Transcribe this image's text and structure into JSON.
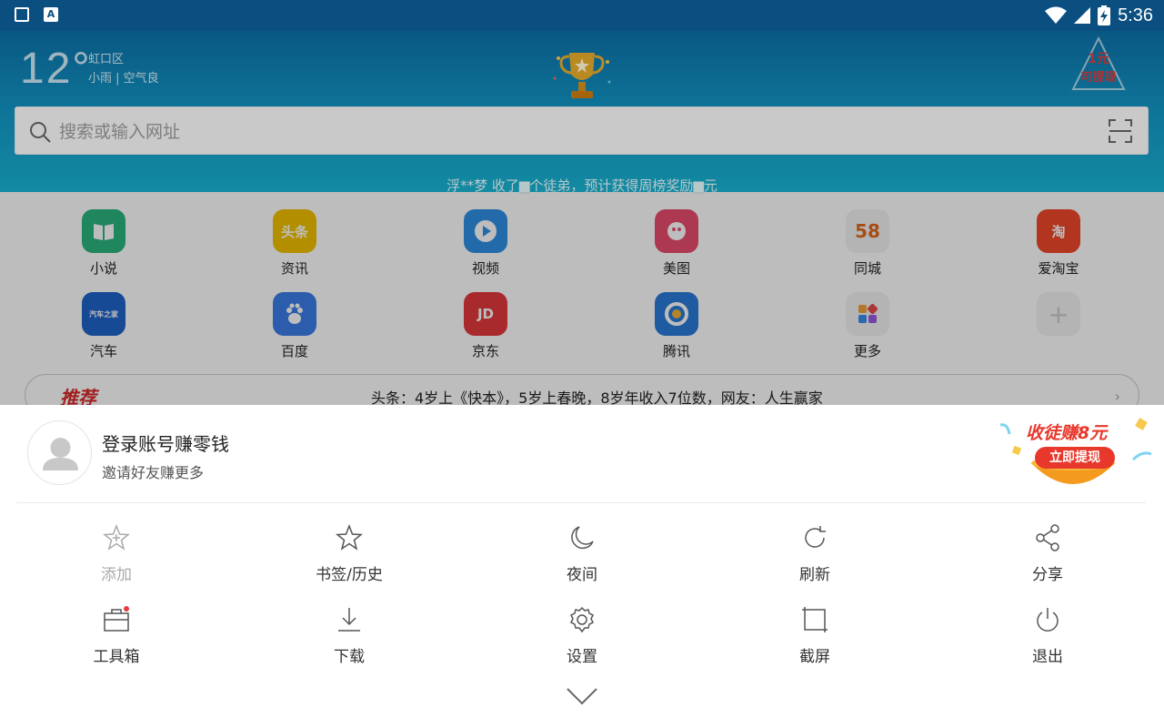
{
  "status_bar": {
    "time": "5:36"
  },
  "weather": {
    "temperature": "12°",
    "district": "虹口区",
    "description": "小雨 | 空气良"
  },
  "cash_badge": {
    "line1": "1元",
    "line2": "可提现"
  },
  "search": {
    "placeholder": "搜索或输入网址"
  },
  "ticker": "浮**梦 收了▆个徒弟，预计获得周榜奖励▆元",
  "quick_links": [
    {
      "label": "小说",
      "icon": "book-icon",
      "color": "#2bb57f",
      "glyph": ""
    },
    {
      "label": "资讯",
      "icon": "toutiao-icon",
      "color": "#f2c200",
      "glyph": "头条"
    },
    {
      "label": "视频",
      "icon": "video-play-icon",
      "color": "#2f8fe6",
      "glyph": ""
    },
    {
      "label": "美图",
      "icon": "meitu-icon",
      "color": "#e94d6e",
      "glyph": ""
    },
    {
      "label": "同城",
      "icon": "58-icon",
      "color": "#f3f3f3",
      "glyph": "58"
    },
    {
      "label": "爱淘宝",
      "icon": "taobao-icon",
      "color": "#f14a2a",
      "glyph": "淘"
    },
    {
      "label": "汽车",
      "icon": "autohome-icon",
      "color": "#1f64c9",
      "glyph": "汽车之家"
    },
    {
      "label": "百度",
      "icon": "baidu-paw-icon",
      "color": "#3b7ee8",
      "glyph": ""
    },
    {
      "label": "京东",
      "icon": "jd-icon",
      "color": "#e4393c",
      "glyph": "JD"
    },
    {
      "label": "腾讯",
      "icon": "tencent-news-icon",
      "color": "#2b7bd9",
      "glyph": ""
    },
    {
      "label": "更多",
      "icon": "more-apps-icon",
      "color": "#f3f3f3",
      "glyph": ""
    },
    {
      "label": "",
      "icon": "add-icon",
      "color": "#f3f3f3",
      "glyph": "+"
    }
  ],
  "recommend": {
    "tag": "推荐",
    "headline": "头条：4岁上《快本》，5岁上春晚，8岁年收入7位数，网友：人生赢家"
  },
  "account": {
    "title": "登录账号赚零钱",
    "subtitle": "邀请好友赚更多"
  },
  "promo": {
    "title": "收徒赚8元",
    "button": "立即提现"
  },
  "menu": [
    {
      "label": "添加",
      "icon": "add-star-icon",
      "enabled": false
    },
    {
      "label": "书签/历史",
      "icon": "star-icon",
      "enabled": true
    },
    {
      "label": "夜间",
      "icon": "moon-icon",
      "enabled": true
    },
    {
      "label": "刷新",
      "icon": "refresh-icon",
      "enabled": true
    },
    {
      "label": "分享",
      "icon": "share-icon",
      "enabled": true
    },
    {
      "label": "工具箱",
      "icon": "toolbox-icon",
      "enabled": true
    },
    {
      "label": "下载",
      "icon": "download-icon",
      "enabled": true
    },
    {
      "label": "设置",
      "icon": "gear-icon",
      "enabled": true
    },
    {
      "label": "截屏",
      "icon": "screenshot-icon",
      "enabled": true
    },
    {
      "label": "退出",
      "icon": "power-icon",
      "enabled": true
    }
  ]
}
